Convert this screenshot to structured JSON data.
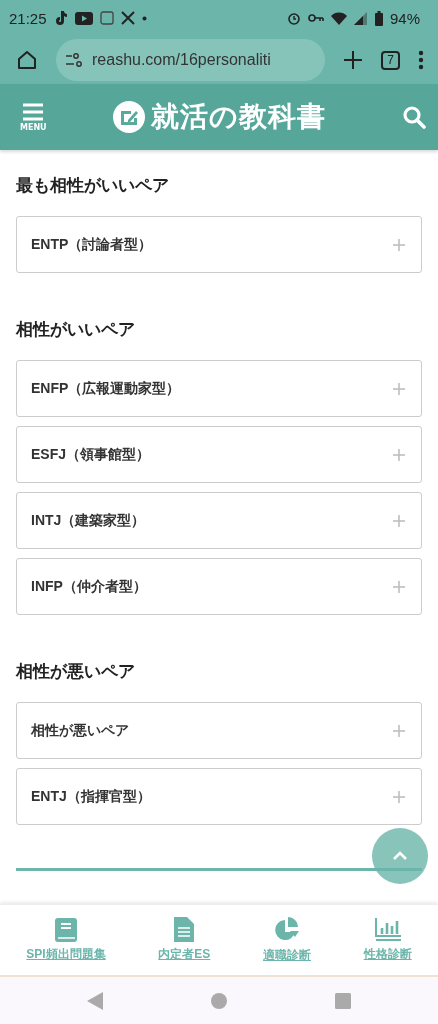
{
  "status_bar": {
    "time": "21:25",
    "battery": "94%"
  },
  "browser": {
    "url": "reashu.com/16personaliti",
    "tab_count": "7"
  },
  "header": {
    "menu_label": "MENU",
    "logo": "就活の教科書"
  },
  "sections": [
    {
      "heading": "最も相性がいいペア",
      "items": [
        {
          "label": "ENTP（討論者型）",
          "expanded": false
        }
      ]
    },
    {
      "heading": "相性がいいペア",
      "items": [
        {
          "label": "ENFP（広報運動家型）",
          "expanded": false
        },
        {
          "label": "ESFJ（領事館型）",
          "expanded": false
        },
        {
          "label": "INTJ（建築家型）",
          "expanded": false
        },
        {
          "label": "INFP（仲介者型）",
          "expanded": false
        }
      ]
    },
    {
      "heading": "相性が悪いペア",
      "items": [
        {
          "label": "相性が悪いペア",
          "expanded": false
        },
        {
          "label": "ENTJ（指揮官型）",
          "expanded": false
        }
      ]
    }
  ],
  "bottom_nav": [
    {
      "label": "SPI頻出問題集",
      "kind": "book"
    },
    {
      "label": "内定者ES",
      "kind": "document"
    },
    {
      "label": "適職診断",
      "kind": "pie"
    },
    {
      "label": "性格診断",
      "kind": "bars"
    }
  ]
}
